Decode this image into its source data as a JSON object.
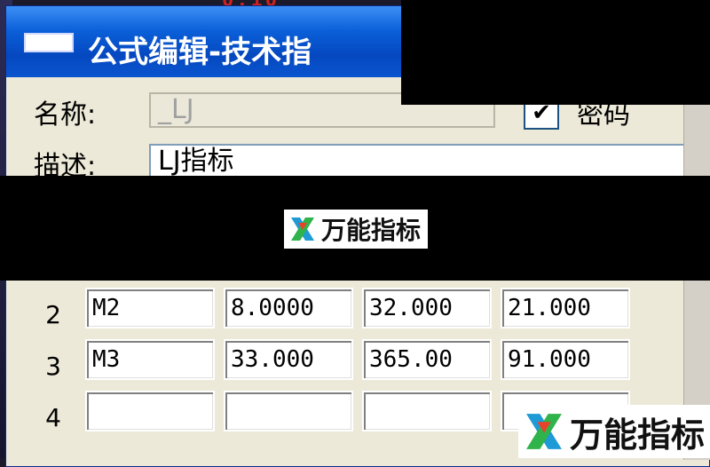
{
  "clock": "0:10",
  "window": {
    "title": "公式编辑-技术指",
    "name_label": "名称:",
    "name_value": "_LJ",
    "description_label": "描述:",
    "description_value": "LJ指标",
    "password_label": "密码",
    "password_checked": "✔"
  },
  "watermark": {
    "text": "万能指标"
  },
  "params": {
    "rows": [
      {
        "num": "2",
        "name": "M2",
        "min": "8.0000",
        "max": "32.000",
        "default": "21.000"
      },
      {
        "num": "3",
        "name": "M3",
        "min": "33.000",
        "max": "365.00",
        "default": "91.000"
      },
      {
        "num": "4",
        "name": "",
        "min": "",
        "max": "",
        "default": ""
      }
    ]
  }
}
